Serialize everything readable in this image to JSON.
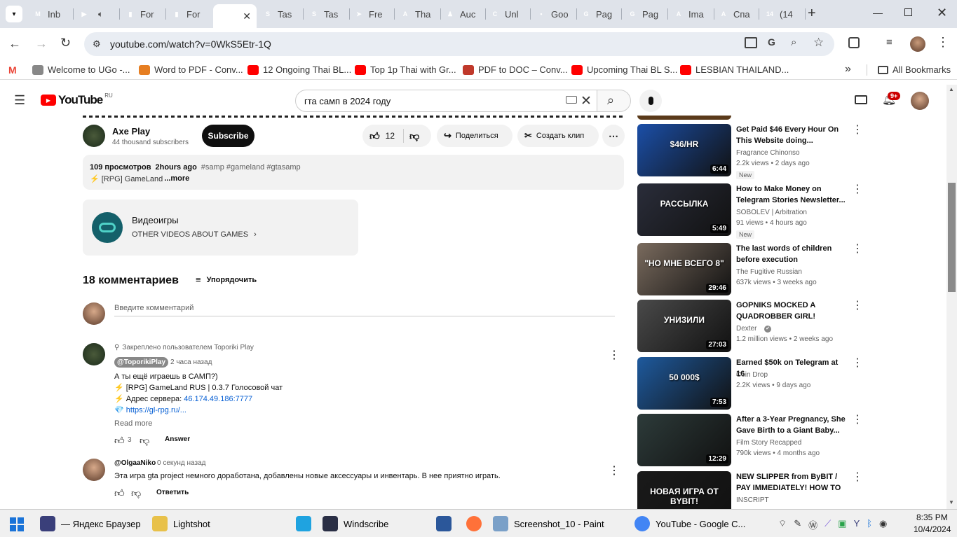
{
  "browser": {
    "tabs": [
      {
        "label": "Inb",
        "color": "#ea4335",
        "glyph": "M"
      },
      {
        "label": "",
        "color": "#ff0000",
        "glyph": "▶"
      },
      {
        "label": "For",
        "color": "#4285f4",
        "glyph": "▮"
      },
      {
        "label": "For",
        "color": "#4285f4",
        "glyph": "▮"
      },
      {
        "label": "",
        "color": "#ff0000",
        "glyph": "▶"
      },
      {
        "label": "Tas",
        "color": "#e1306c",
        "glyph": "S"
      },
      {
        "label": "Tas",
        "color": "#e1306c",
        "glyph": "S"
      },
      {
        "label": "Fre",
        "color": "#2aa3df",
        "glyph": "➤"
      },
      {
        "label": "Tha",
        "color": "#9b1c1c",
        "glyph": "A"
      },
      {
        "label": "Auc",
        "color": "#fbbc05",
        "glyph": "♟"
      },
      {
        "label": "Unl",
        "color": "#7c4dff",
        "glyph": "C"
      },
      {
        "label": "Goo",
        "color": "#f4b400",
        "glyph": "▪"
      },
      {
        "label": "Pag",
        "color": "#4285f4",
        "glyph": "G"
      },
      {
        "label": "Pag",
        "color": "#4285f4",
        "glyph": "G"
      },
      {
        "label": "Ima",
        "color": "#333333",
        "glyph": "A"
      },
      {
        "label": "Спа",
        "color": "#9b1c1c",
        "glyph": "A"
      },
      {
        "label": "(14",
        "color": "#25d366",
        "glyph": "14"
      }
    ],
    "url": "youtube.com/watch?v=0WkS5Etr-1Q",
    "bookmarks": [
      {
        "label": "Welcome to UGo -...",
        "color": "#888888"
      },
      {
        "label": "Word to PDF - Conv...",
        "color": "#e67e22"
      },
      {
        "label": "12 Ongoing Thai BL...",
        "color": "#ff0000"
      },
      {
        "label": "Top 1p Thai with Gr...",
        "color": "#ff0000"
      },
      {
        "label": "PDF to DOC – Conv...",
        "color": "#c0392b"
      },
      {
        "label": "Upcoming Thai BL S...",
        "color": "#ff0000"
      },
      {
        "label": "LESBIAN THAILAND...",
        "color": "#ff0000"
      }
    ],
    "all_bookmarks": "All Bookmarks",
    "more_bookmarks": "»"
  },
  "yt": {
    "logo": "YouTube",
    "region": "RU",
    "search_value": "гта самп в 2024 году",
    "notif_count": "9+",
    "channel": {
      "name": "Axe Play",
      "subs": "44 thousand subscribers",
      "subscribe": "Subscribe"
    },
    "likes": "12",
    "share": "Поделиться",
    "clip": "Создать клип",
    "desc": {
      "views": "109 просмотров",
      "time": "2hours ago",
      "tags": "#samp #gameland #gtasamp",
      "text": "⚡ [RPG] GameLand",
      "more": "...more"
    },
    "category": {
      "title": "Видеоигры",
      "link": "OTHER VIDEOS ABOUT GAMES"
    },
    "comments": {
      "count": "18 комментариев",
      "sort": "Упорядочить",
      "placeholder": "Введите комментарий",
      "pinned_by": "Закреплено пользователем Toporiki Play",
      "c1": {
        "author": "@ToporikiPlay",
        "time": "2 часа назад",
        "lines": [
          "А ты ещё играешь в САМП?)",
          "⚡ [RPG] GameLand RUS | 0.3.7 Голосовой чат",
          "⚡ Адрес сервера: ",
          "💎 "
        ],
        "ip": "46.174.49.186:7777",
        "link": "https://gl-rpg.ru/...",
        "read_more": "Read more",
        "likes": "3",
        "reply": "Answer"
      },
      "c2": {
        "author": "@OlgaaNiko",
        "time": "0 секунд назад",
        "text": "Эта игра gta project немного доработана, добавлены новые аксессуары и инвентарь. В нее приятно играть.",
        "reply": "Ответить"
      }
    },
    "related": [
      {
        "title": "Get Paid $46 Every Hour On This Website doing...",
        "channel": "Fragrance Chinonso",
        "meta": "2.2k views • 2 days ago",
        "dur": "6:44",
        "new": "New",
        "bg": "#1b4fa8",
        "overlay": "$46/HR"
      },
      {
        "title": "How to Make Money on Telegram Stories Newsletter...",
        "channel": "SOBOLEV | Arbitration",
        "meta": "91 views • 4 hours ago",
        "dur": "5:49",
        "new": "New",
        "bg": "#2a2d3a",
        "overlay": "РАССЫЛКА"
      },
      {
        "title": "The last words of children before execution",
        "channel": "The Fugitive Russian",
        "meta": "637k views • 3 weeks ago",
        "dur": "29:46",
        "new": "",
        "bg": "#7a6b5e",
        "overlay": "\"НО МНЕ ВСЕГО 8\""
      },
      {
        "title": "GOPNIKS MOCKED A QUADROBBER GIRL! Punished!",
        "channel": "Dexter",
        "meta": "1.2 million views • 2 weeks ago",
        "dur": "27:03",
        "new": "",
        "bg": "#4a4a4a",
        "overlay": "УНИЗИЛИ"
      },
      {
        "title": "Earned $50k on Telegram at 16",
        "channel": "Coin Drop",
        "meta": "2.2K views • 9 days ago",
        "dur": "7:53",
        "new": "",
        "bg": "#1e5a9e",
        "overlay": "50 000$"
      },
      {
        "title": "After a 3-Year Pregnancy, She Gave Birth to a Giant Baby...",
        "channel": "Film Story Recapped",
        "meta": "790k views • 4 months ago",
        "dur": "12:29",
        "new": "",
        "bg": "#2d3b3a",
        "overlay": ""
      },
      {
        "title": "NEW SLIPPER from ByBIT / PAY IMMEDIATELY! HOW TO MAKE...",
        "channel": "INSCRIPT",
        "meta": "",
        "dur": "",
        "new": "",
        "bg": "#1a1a1a",
        "overlay": "НОВАЯ ИГРА ОТ BYBIT!"
      }
    ]
  },
  "taskbar": {
    "items": [
      {
        "label": "— Яндекс Браузер",
        "color": "#3a3f7a"
      },
      {
        "label": "Lightshot",
        "color": "#e8c14a"
      },
      {
        "label": "",
        "color": "#1fa3e0"
      },
      {
        "label": "Windscribe",
        "color": "#2a2f45"
      },
      {
        "label": "",
        "color": "#2b579a"
      },
      {
        "label": "",
        "color": "#ff7139"
      },
      {
        "label": "Screenshot_10 - Paint",
        "color": "#7aa0c8"
      },
      {
        "label": "YouTube - Google C...",
        "color": "#4285f4"
      }
    ],
    "time": "8:35 PM",
    "date": "10/4/2024"
  }
}
